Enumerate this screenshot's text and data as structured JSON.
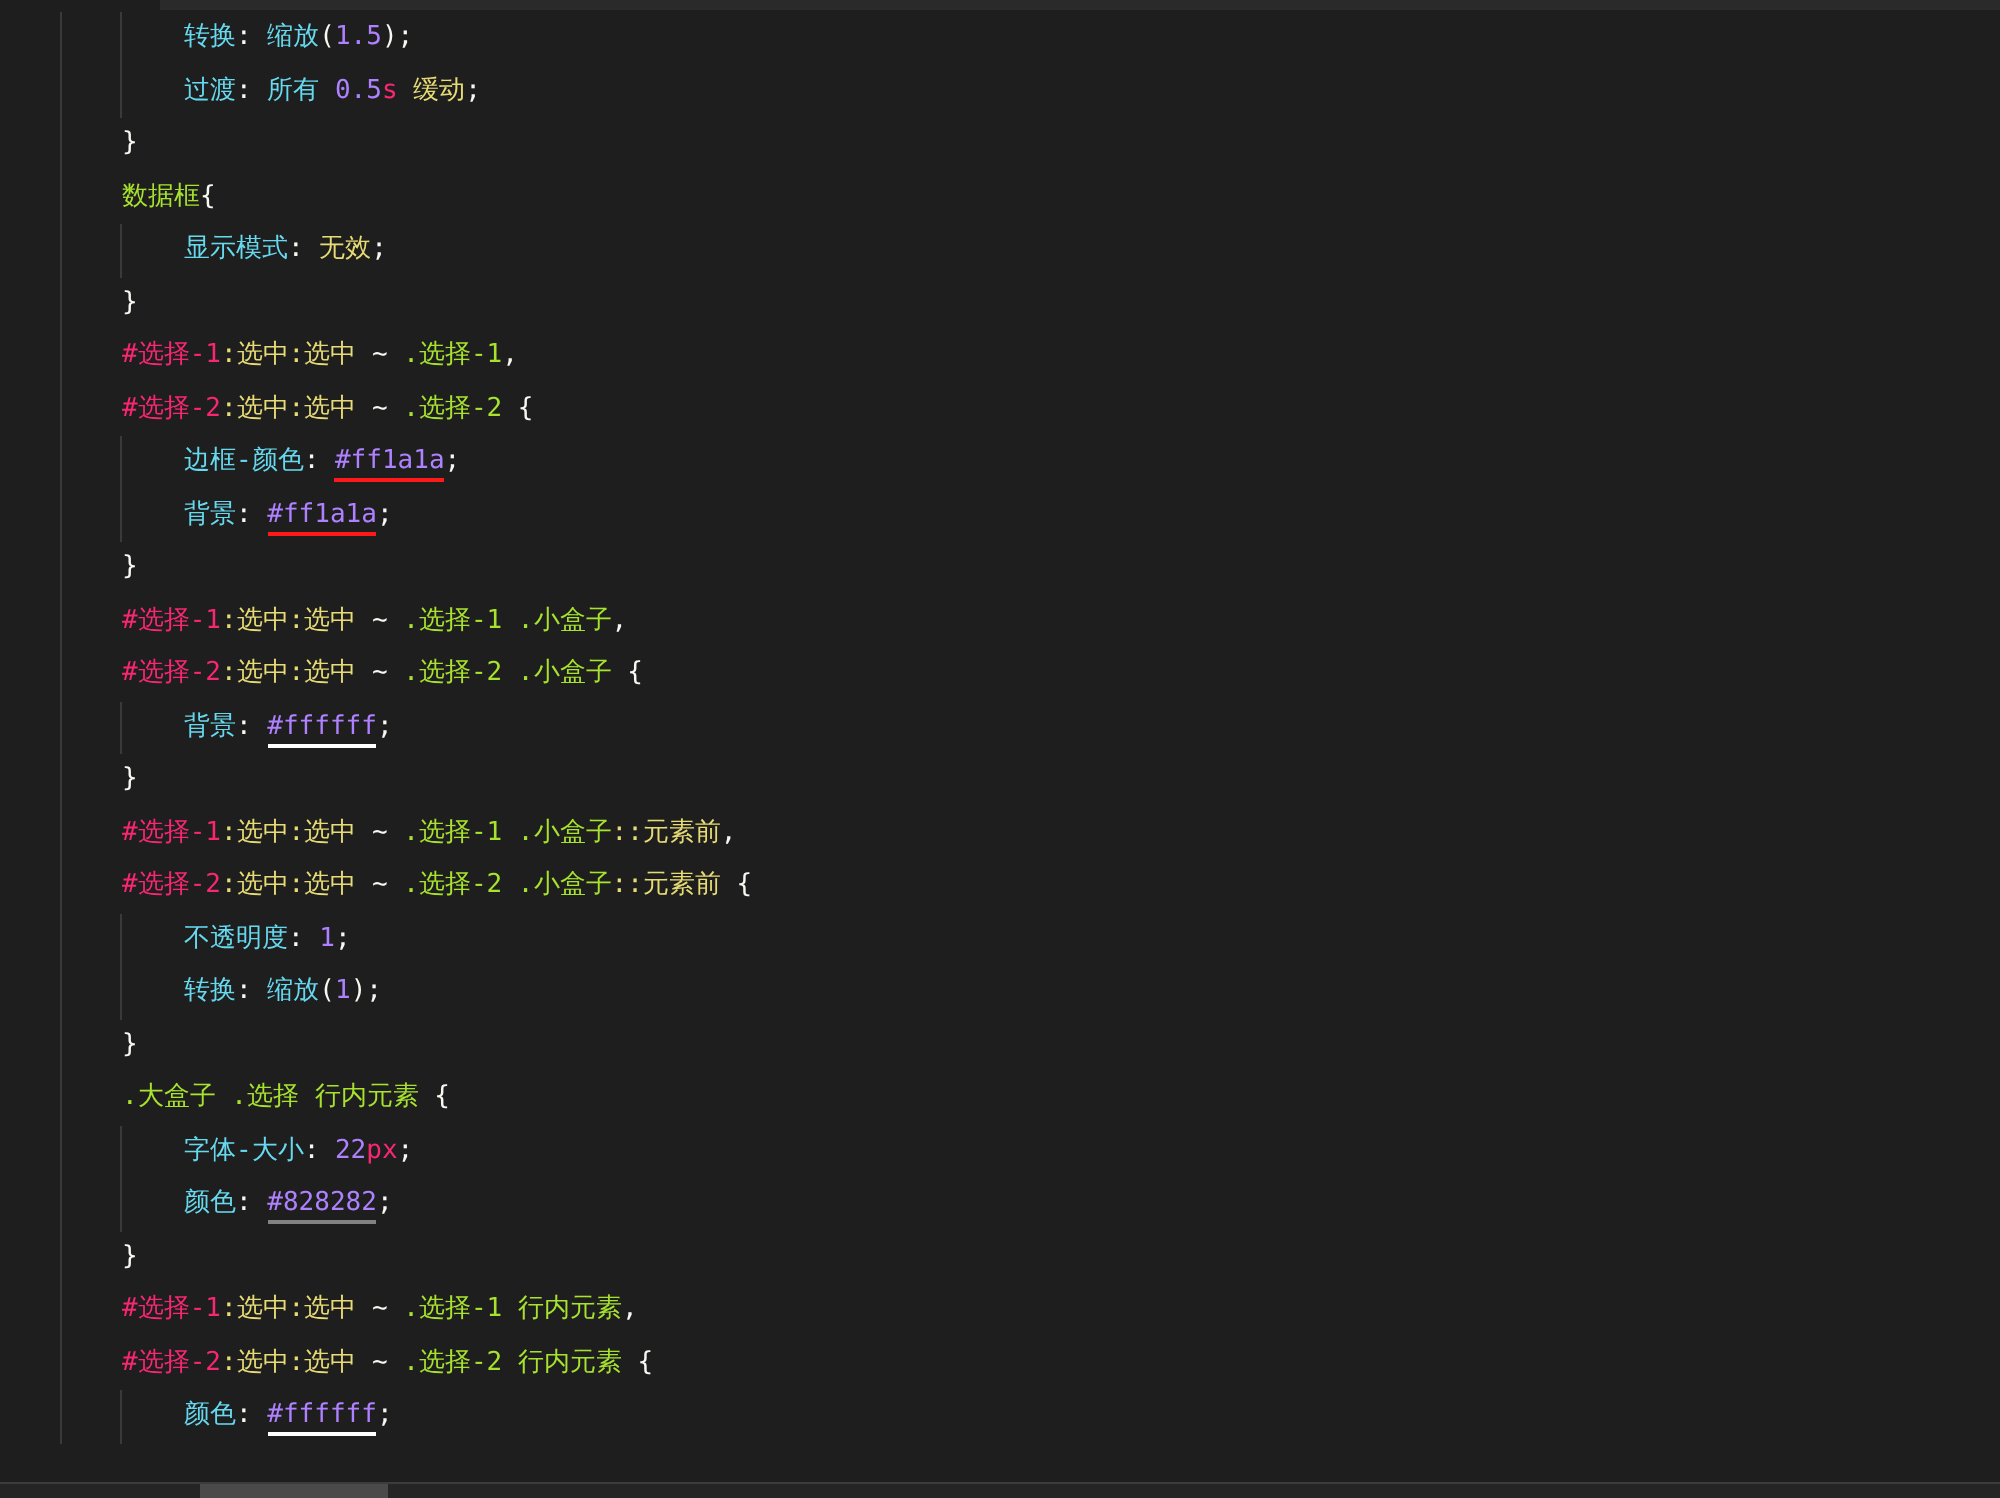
{
  "rules": [
    {
      "declarations": [
        [
          {
            "kind": "property",
            "text": "转换"
          },
          {
            "kind": "punct",
            "text": ": "
          },
          {
            "kind": "function",
            "text": "缩放"
          },
          {
            "kind": "punct",
            "text": "("
          },
          {
            "kind": "number",
            "text": "1.5"
          },
          {
            "kind": "punct",
            "text": ");"
          }
        ],
        [
          {
            "kind": "property",
            "text": "过渡"
          },
          {
            "kind": "punct",
            "text": ": "
          },
          {
            "kind": "function",
            "text": "所有 "
          },
          {
            "kind": "number",
            "text": "0.5"
          },
          {
            "kind": "unit",
            "text": "s"
          },
          {
            "kind": "value",
            "text": " 缓动"
          },
          {
            "kind": "punct",
            "text": ";"
          }
        ]
      ],
      "closing": "}"
    },
    {
      "selector_lines": [
        [
          {
            "kind": "class",
            "text": "数据框"
          },
          {
            "kind": "punct",
            "text": "{"
          }
        ]
      ],
      "declarations": [
        [
          {
            "kind": "property",
            "text": "显示模式"
          },
          {
            "kind": "punct",
            "text": ": "
          },
          {
            "kind": "value",
            "text": "无效"
          },
          {
            "kind": "punct",
            "text": ";"
          }
        ]
      ],
      "closing": "}"
    },
    {
      "selector_lines": [
        [
          {
            "kind": "id",
            "text": "#选择-1"
          },
          {
            "kind": "pseudo",
            "text": ":选中:选中"
          },
          {
            "kind": "punct",
            "text": " ~ "
          },
          {
            "kind": "class",
            "text": ".选择-1"
          },
          {
            "kind": "punct",
            "text": ","
          }
        ],
        [
          {
            "kind": "id",
            "text": "#选择-2"
          },
          {
            "kind": "pseudo",
            "text": ":选中:选中"
          },
          {
            "kind": "punct",
            "text": " ~ "
          },
          {
            "kind": "class",
            "text": ".选择-2"
          },
          {
            "kind": "punct",
            "text": " {"
          }
        ]
      ],
      "declarations": [
        [
          {
            "kind": "property",
            "text": "边框-颜色"
          },
          {
            "kind": "punct",
            "text": ": "
          },
          {
            "kind": "hex",
            "text": "#ff1a1a",
            "color": "#ff1a1a"
          },
          {
            "kind": "punct",
            "text": ";"
          }
        ],
        [
          {
            "kind": "property",
            "text": "背景"
          },
          {
            "kind": "punct",
            "text": ": "
          },
          {
            "kind": "hex",
            "text": "#ff1a1a",
            "color": "#ff1a1a"
          },
          {
            "kind": "punct",
            "text": ";"
          }
        ]
      ],
      "closing": "}"
    },
    {
      "selector_lines": [
        [
          {
            "kind": "id",
            "text": "#选择-1"
          },
          {
            "kind": "pseudo",
            "text": ":选中:选中"
          },
          {
            "kind": "punct",
            "text": " ~ "
          },
          {
            "kind": "class",
            "text": ".选择-1 .小盒子"
          },
          {
            "kind": "punct",
            "text": ","
          }
        ],
        [
          {
            "kind": "id",
            "text": "#选择-2"
          },
          {
            "kind": "pseudo",
            "text": ":选中:选中"
          },
          {
            "kind": "punct",
            "text": " ~ "
          },
          {
            "kind": "class",
            "text": ".选择-2 .小盒子"
          },
          {
            "kind": "punct",
            "text": " {"
          }
        ]
      ],
      "declarations": [
        [
          {
            "kind": "property",
            "text": "背景"
          },
          {
            "kind": "punct",
            "text": ": "
          },
          {
            "kind": "hex",
            "text": "#ffffff",
            "color": "#ffffff"
          },
          {
            "kind": "punct",
            "text": ";"
          }
        ]
      ],
      "closing": "}"
    },
    {
      "selector_lines": [
        [
          {
            "kind": "id",
            "text": "#选择-1"
          },
          {
            "kind": "pseudo",
            "text": ":选中:选中"
          },
          {
            "kind": "punct",
            "text": " ~ "
          },
          {
            "kind": "class",
            "text": ".选择-1 .小盒子"
          },
          {
            "kind": "pseudo",
            "text": "::元素前"
          },
          {
            "kind": "punct",
            "text": ","
          }
        ],
        [
          {
            "kind": "id",
            "text": "#选择-2"
          },
          {
            "kind": "pseudo",
            "text": ":选中:选中"
          },
          {
            "kind": "punct",
            "text": " ~ "
          },
          {
            "kind": "class",
            "text": ".选择-2 .小盒子"
          },
          {
            "kind": "pseudo",
            "text": "::元素前"
          },
          {
            "kind": "punct",
            "text": " {"
          }
        ]
      ],
      "declarations": [
        [
          {
            "kind": "property",
            "text": "不透明度"
          },
          {
            "kind": "punct",
            "text": ": "
          },
          {
            "kind": "number",
            "text": "1"
          },
          {
            "kind": "punct",
            "text": ";"
          }
        ],
        [
          {
            "kind": "property",
            "text": "转换"
          },
          {
            "kind": "punct",
            "text": ": "
          },
          {
            "kind": "function",
            "text": "缩放"
          },
          {
            "kind": "punct",
            "text": "("
          },
          {
            "kind": "number",
            "text": "1"
          },
          {
            "kind": "punct",
            "text": ");"
          }
        ]
      ],
      "closing": "}"
    },
    {
      "selector_lines": [
        [
          {
            "kind": "class",
            "text": ".大盒子 .选择 行内元素"
          },
          {
            "kind": "punct",
            "text": " {"
          }
        ]
      ],
      "declarations": [
        [
          {
            "kind": "property",
            "text": "字体-大小"
          },
          {
            "kind": "punct",
            "text": ": "
          },
          {
            "kind": "number",
            "text": "22"
          },
          {
            "kind": "unit",
            "text": "px"
          },
          {
            "kind": "punct",
            "text": ";"
          }
        ],
        [
          {
            "kind": "property",
            "text": "颜色"
          },
          {
            "kind": "punct",
            "text": ": "
          },
          {
            "kind": "hex",
            "text": "#828282",
            "color": "#828282"
          },
          {
            "kind": "punct",
            "text": ";"
          }
        ]
      ],
      "closing": "}"
    },
    {
      "selector_lines": [
        [
          {
            "kind": "id",
            "text": "#选择-1"
          },
          {
            "kind": "pseudo",
            "text": ":选中:选中"
          },
          {
            "kind": "punct",
            "text": " ~ "
          },
          {
            "kind": "class",
            "text": ".选择-1 行内元素"
          },
          {
            "kind": "punct",
            "text": ","
          }
        ],
        [
          {
            "kind": "id",
            "text": "#选择-2"
          },
          {
            "kind": "pseudo",
            "text": ":选中:选中"
          },
          {
            "kind": "punct",
            "text": " ~ "
          },
          {
            "kind": "class",
            "text": ".选择-2 行内元素"
          },
          {
            "kind": "punct",
            "text": " {"
          }
        ]
      ],
      "declarations": [
        [
          {
            "kind": "property",
            "text": "颜色"
          },
          {
            "kind": "punct",
            "text": ": "
          },
          {
            "kind": "hex",
            "text": "#ffffff",
            "color": "#ffffff"
          },
          {
            "kind": "punct",
            "text": ";"
          }
        ]
      ]
    }
  ]
}
